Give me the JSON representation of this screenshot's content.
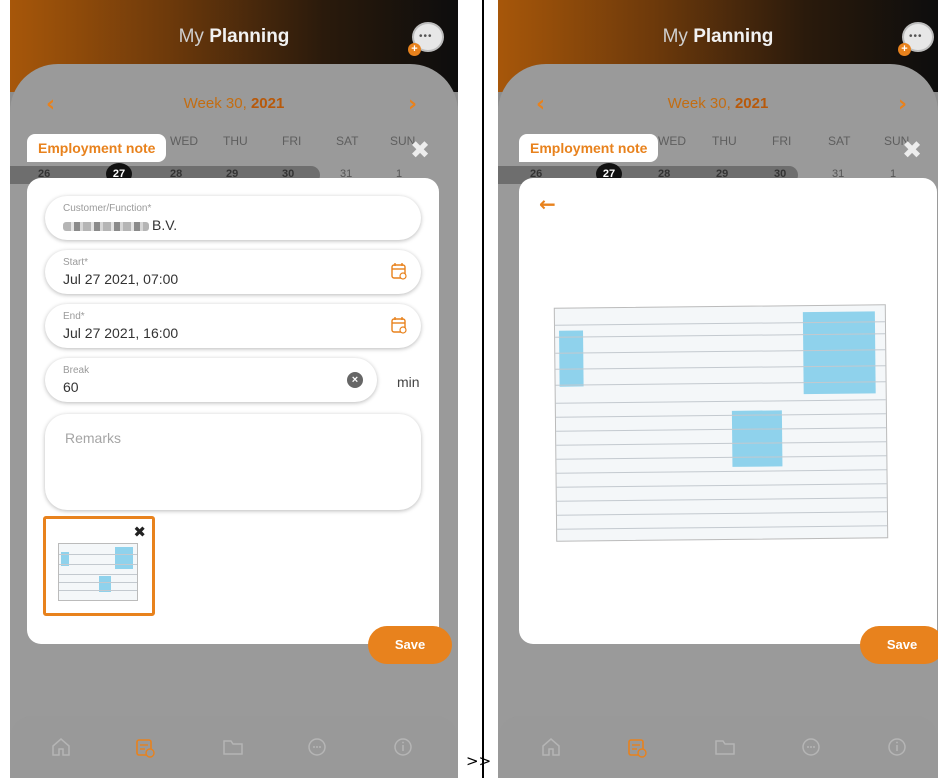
{
  "separator": ">>",
  "colors": {
    "accent": "#e8821d",
    "overlay": "#8d8d8d"
  },
  "header": {
    "title_light": "My ",
    "title_bold": "Planning",
    "chat_icon": "chat-add-icon"
  },
  "week": {
    "label": "Week 30, ",
    "year": "2021"
  },
  "days": [
    "WED",
    "THU",
    "FRI",
    "SAT",
    "SUN"
  ],
  "dates": [
    "26",
    "27",
    "28",
    "29",
    "30",
    "31",
    "1"
  ],
  "today": "27",
  "modal": {
    "title": "Employment note",
    "customer": {
      "label": "Customer/Function*",
      "value": "B.V."
    },
    "start": {
      "label": "Start*",
      "value": "Jul 27 2021, 07:00"
    },
    "end": {
      "label": "End*",
      "value": "Jul 27 2021, 16:00"
    },
    "break": {
      "label": "Break",
      "value": "60",
      "unit": "min"
    },
    "remarks": {
      "placeholder": "Remarks"
    },
    "save_label": "Save"
  },
  "tabs": [
    "home-icon",
    "planning-icon",
    "folder-icon",
    "chat-icon",
    "info-icon"
  ],
  "active_tab": "planning-icon"
}
